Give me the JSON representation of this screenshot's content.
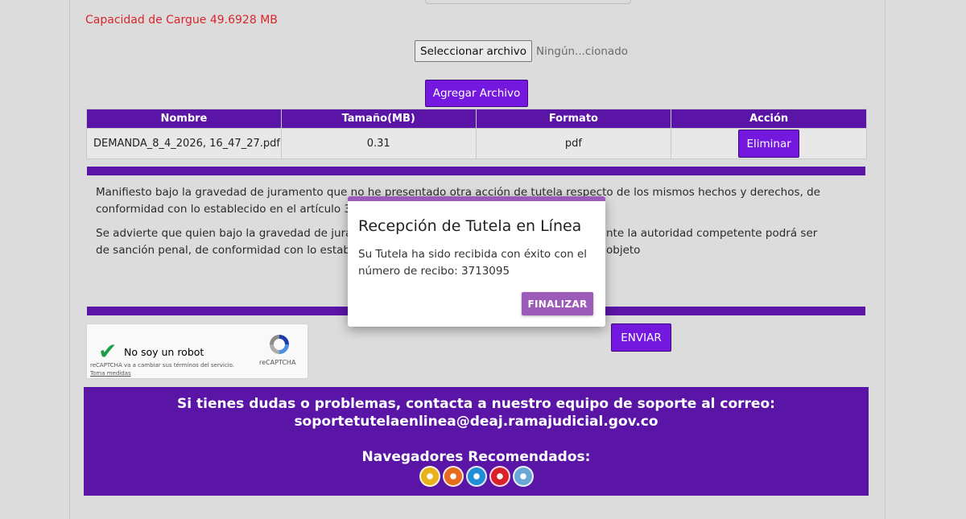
{
  "upload": {
    "capacity_text": "Capacidad de Cargue 49.6928 MB",
    "file_button_label": "Seleccionar archivo",
    "file_name_text": "Ningún...cionado",
    "add_button_label": "Agregar Archivo"
  },
  "files_table": {
    "headers": [
      "Nombre",
      "Tamaño(MB)",
      "Formato",
      "Acción"
    ],
    "rows": [
      {
        "name": "DEMANDA_8_4_2026, 16_47_27.pdf",
        "size": "0.31",
        "format": "pdf",
        "action_label": "Eliminar"
      }
    ]
  },
  "legal": {
    "paragraph1_line1": "Manifiesto bajo la gravedad de juramento que no he presentado otra acción de tutela respecto de los mismos hechos y derechos, de",
    "paragraph1_line2": "conformidad con lo establecido en el artículo 37",
    "paragraph2_line1_start": "Se advierte que quien bajo la gravedad de juram",
    "paragraph2_line1_end": "nte la autoridad competente podrá ser objeto",
    "paragraph2_line2": "de sanción penal, de conformidad con lo estable"
  },
  "recaptcha": {
    "label": "No soy un robot",
    "terms_text": "reCAPTCHA va a cambiar sus términos del servicio.",
    "terms_link": "Toma medidas",
    "brand": "reCAPTCHA"
  },
  "send_button_label": "ENVIAR",
  "support": {
    "line1": "Si tienes dudas o problemas, contacta a nuestro equipo de soporte al correo:",
    "email": "soportetutelaenlinea@deaj.ramajudicial.gov.co",
    "browsers_title": "Navegadores Recomendados:",
    "browsers": [
      {
        "icon": "chrome-icon",
        "color": "#e8b21a"
      },
      {
        "icon": "firefox-icon",
        "color": "#e66a1f"
      },
      {
        "icon": "edge-icon",
        "color": "#1f8ed6"
      },
      {
        "icon": "opera-icon",
        "color": "#d8232a"
      },
      {
        "icon": "safari-icon",
        "color": "#6aa7d6"
      }
    ]
  },
  "modal": {
    "title": "Recepción de Tutela en Línea",
    "body_line1": "Su Tutela ha sido recibida con éxito con el",
    "body_line2": "número de recibo: 3713095",
    "button_label": "FINALIZAR"
  },
  "colors": {
    "primary": "#7418e0",
    "header_purple": "#5a14a6",
    "modal_accent": "#9c5bb8",
    "warning_red": "#d9262c"
  }
}
